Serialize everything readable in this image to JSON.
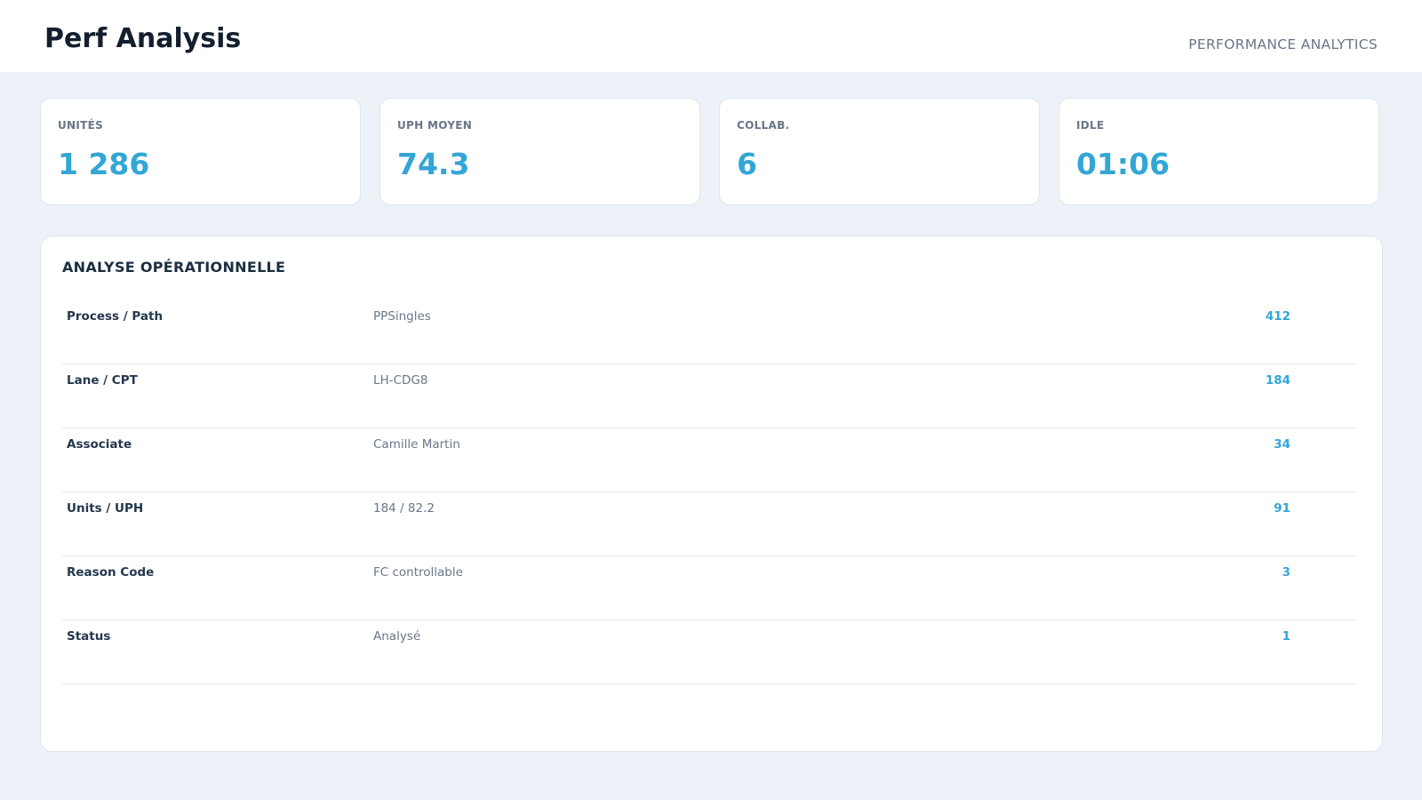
{
  "header": {
    "title": "Perf Analysis",
    "subtitle": "PERFORMANCE ANALYTICS"
  },
  "kpis": [
    {
      "label": "UNITÉS",
      "value": "1 286"
    },
    {
      "label": "UPH MOYEN",
      "value": "74.3"
    },
    {
      "label": "COLLAB.",
      "value": "6"
    },
    {
      "label": "IDLE",
      "value": "01:06"
    }
  ],
  "panel": {
    "title": "ANALYSE OPÉRATIONNELLE",
    "rows": [
      {
        "label": "Process / Path",
        "value": "PPSingles",
        "count": "412"
      },
      {
        "label": "Lane / CPT",
        "value": "LH-CDG8",
        "count": "184"
      },
      {
        "label": "Associate",
        "value": "Camille Martin",
        "count": "34"
      },
      {
        "label": "Units / UPH",
        "value": "184 / 82.2",
        "count": "91"
      },
      {
        "label": "Reason Code",
        "value": "FC controllable",
        "count": "3"
      },
      {
        "label": "Status",
        "value": "Analysé",
        "count": "1"
      }
    ]
  },
  "colors": {
    "accent": "#33a6d6",
    "background": "#edf2f8",
    "title": "#131f2e"
  }
}
